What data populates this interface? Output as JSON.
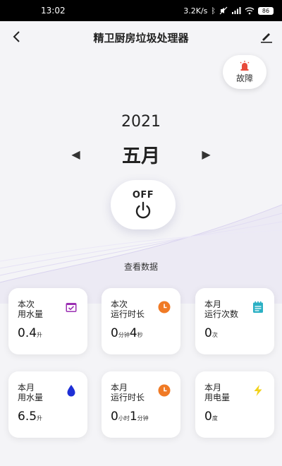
{
  "status_bar": {
    "time": "13:02",
    "speed": "3.2K/s",
    "battery": "86"
  },
  "header": {
    "title": "精卫厨房垃圾处理器",
    "back_icon": "chevron-left-icon",
    "edit_icon": "pencil-icon"
  },
  "fault_button": {
    "label": "故障",
    "icon": "alarm-light-icon",
    "color": "#e84a3a"
  },
  "date": {
    "year": "2021",
    "month": "五月",
    "prev_arrow": "◀",
    "next_arrow": "▶"
  },
  "power_button": {
    "label": "OFF",
    "icon": "power-icon"
  },
  "view_data_label": "查看数据",
  "stats": [
    {
      "line1": "本次",
      "line2": "用水量",
      "icon": "calendar-check-icon",
      "icon_color": "#9b2fb3",
      "value_parts": [
        {
          "num": "0.4",
          "unit": "升"
        }
      ]
    },
    {
      "line1": "本次",
      "line2": "运行时长",
      "icon": "clock-icon",
      "icon_color": "#f07a25",
      "value_parts": [
        {
          "num": "0",
          "unit": "分钟"
        },
        {
          "num": "4",
          "unit": "秒"
        }
      ]
    },
    {
      "line1": "本月",
      "line2": "运行次数",
      "icon": "notepad-icon",
      "icon_color": "#2bb0c4",
      "value_parts": [
        {
          "num": "0",
          "unit": "次"
        }
      ]
    },
    {
      "line1": "本月",
      "line2": "用水量",
      "icon": "water-drop-icon",
      "icon_color": "#1e2fd6",
      "value_parts": [
        {
          "num": "6.5",
          "unit": "升"
        }
      ]
    },
    {
      "line1": "本月",
      "line2": "运行时长",
      "icon": "clock-icon",
      "icon_color": "#f07a25",
      "value_parts": [
        {
          "num": "0",
          "unit": "小时"
        },
        {
          "num": "1",
          "unit": "分钟"
        }
      ]
    },
    {
      "line1": "本月",
      "line2": "用电量",
      "icon": "lightning-icon",
      "icon_color": "#f2d21a",
      "value_parts": [
        {
          "num": "0",
          "unit": "度"
        }
      ]
    }
  ]
}
